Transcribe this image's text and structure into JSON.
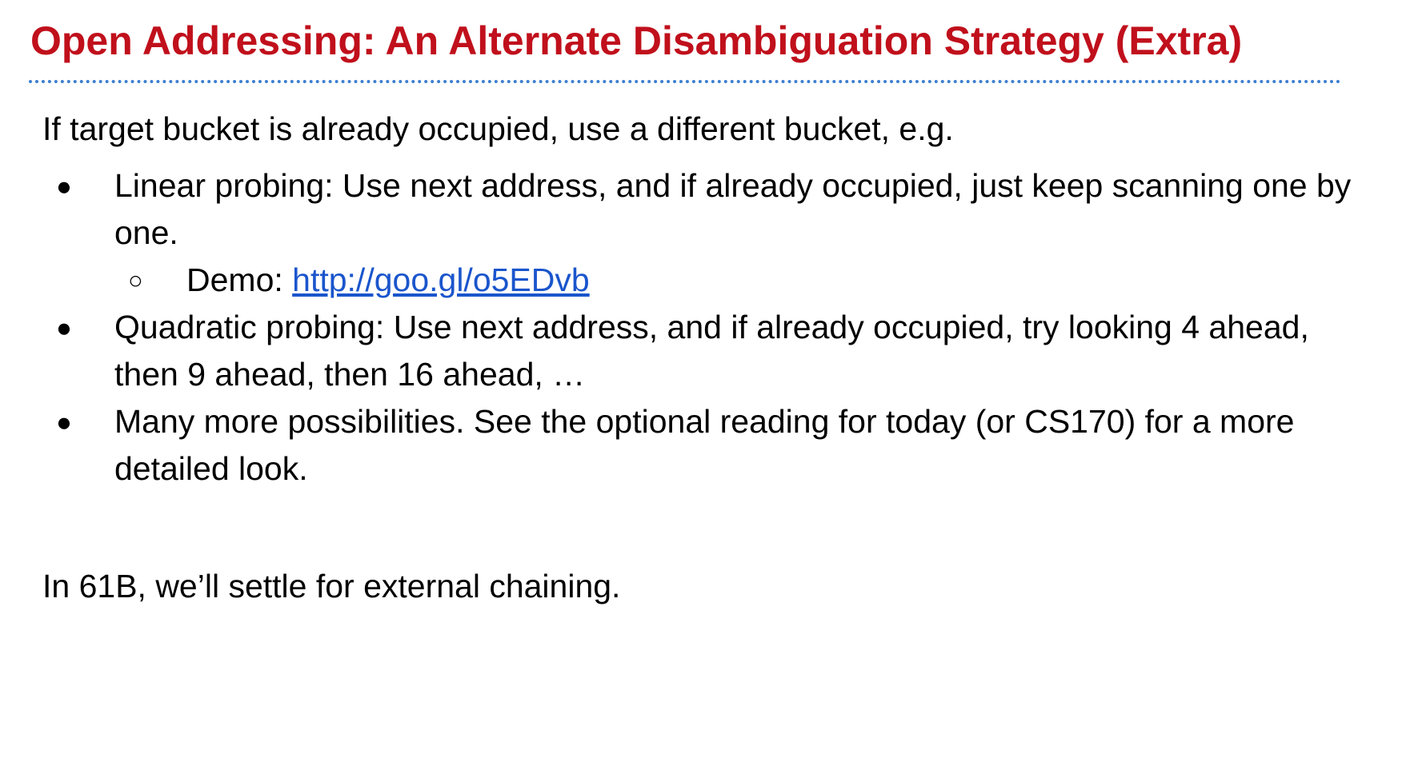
{
  "slide": {
    "title": "Open Addressing: An Alternate Disambiguation Strategy (Extra)",
    "intro": "If target bucket is already occupied, use a different bucket, e.g.",
    "bullets": [
      {
        "glyph": "●",
        "text": "Linear probing: Use next address, and if already occupied, just keep scanning one by one.",
        "sub": {
          "glyph": "○",
          "label": "Demo: ",
          "link_text": "http://goo.gl/o5EDvb"
        }
      },
      {
        "glyph": "●",
        "text": "Quadratic probing: Use next address, and if already occupied, try looking 4 ahead, then 9 ahead, then 16 ahead, …"
      },
      {
        "glyph": "●",
        "text": "Many more possibilities. See the optional reading for today (or CS170) for a more detailed look."
      }
    ],
    "closing": "In 61B, we’ll settle for external chaining."
  },
  "colors": {
    "title": "#c0101c",
    "divider": "#3d7fd0",
    "link": "#1a55cc",
    "text": "#000000",
    "background": "#ffffff"
  }
}
